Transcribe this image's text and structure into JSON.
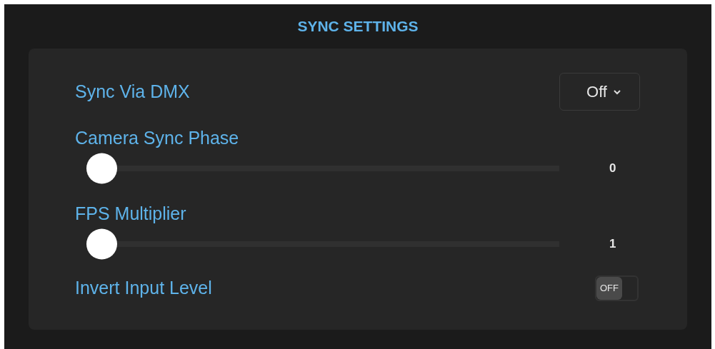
{
  "title": "SYNC SETTINGS",
  "settings": [
    {
      "kind": "select",
      "label": "Sync Via DMX",
      "value": "Off"
    },
    {
      "kind": "slider",
      "label": "Camera Sync Phase",
      "level": 0,
      "reading": "0"
    },
    {
      "kind": "slider",
      "label": "FPS Multiplier",
      "level": 0,
      "reading": "1"
    },
    {
      "kind": "toggle",
      "label": "Invert Input Level",
      "on": false,
      "state_label": "OFF"
    }
  ]
}
